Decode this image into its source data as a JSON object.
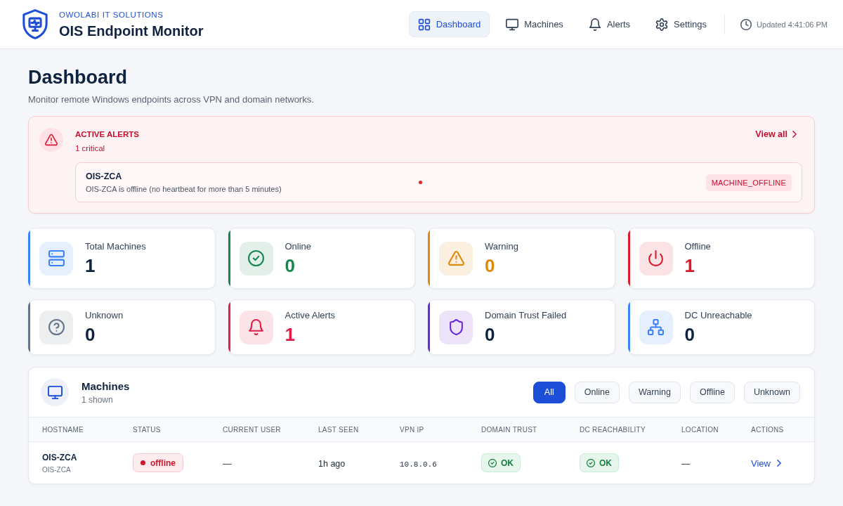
{
  "header": {
    "brand": "OWOLABI IT SOLUTIONS",
    "title": "OIS Endpoint Monitor",
    "nav": [
      {
        "label": "Dashboard",
        "kind": "grid",
        "selected": true
      },
      {
        "label": "Machines",
        "kind": "monitor",
        "selected": false
      },
      {
        "label": "Alerts",
        "kind": "bell",
        "selected": false
      },
      {
        "label": "Settings",
        "kind": "gear",
        "selected": false
      }
    ],
    "updated": "Updated 4:41:06 PM"
  },
  "page": {
    "title": "Dashboard",
    "subtitle": "Monitor remote Windows endpoints across VPN and domain networks."
  },
  "alerts": {
    "title": "ACTIVE ALERTS",
    "summary": "1 critical",
    "link": "View all",
    "items": [
      {
        "host": "OIS-ZCA",
        "message": "OIS-ZCA is offline (no heartbeat for more than 5 minutes)",
        "color": "#dc2626",
        "type": "MACHINE_OFFLINE"
      }
    ]
  },
  "stats": [
    {
      "label": "Total Machines",
      "value": "1",
      "kind": "server",
      "color": "#3b82f6",
      "emphasized": false
    },
    {
      "label": "Online",
      "value": "0",
      "kind": "check",
      "color": "#16874f",
      "emphasized": true
    },
    {
      "label": "Warning",
      "value": "0",
      "kind": "warning",
      "color": "#e08a0a",
      "emphasized": true
    },
    {
      "label": "Offline",
      "value": "1",
      "kind": "power",
      "color": "#d81c2e",
      "emphasized": true
    },
    {
      "label": "Unknown",
      "value": "0",
      "kind": "question",
      "color": "#64748b",
      "emphasized": false
    },
    {
      "label": "Active Alerts",
      "value": "1",
      "kind": "bell",
      "color": "#e11d48",
      "emphasized": true
    },
    {
      "label": "Domain Trust Failed",
      "value": "0",
      "kind": "shield",
      "color": "#6d28d9",
      "emphasized": false
    },
    {
      "label": "DC Unreachable",
      "value": "0",
      "kind": "network",
      "color": "#3b82f6",
      "emphasized": false
    }
  ],
  "machines": {
    "title": "Machines",
    "count": "1 shown",
    "filters": [
      {
        "label": "All",
        "selected": true
      },
      {
        "label": "Online",
        "selected": false
      },
      {
        "label": "Warning",
        "selected": false
      },
      {
        "label": "Offline",
        "selected": false
      },
      {
        "label": "Unknown",
        "selected": false
      }
    ],
    "columns": [
      "HOSTNAME",
      "STATUS",
      "CURRENT USER",
      "LAST SEEN",
      "VPN IP",
      "DOMAIN TRUST",
      "DC REACHABILITY",
      "LOCATION",
      "ACTIONS"
    ],
    "rows": [
      {
        "hostname": "OIS-ZCA",
        "host_detail": "OIS-ZCA",
        "status": {
          "text": "offline",
          "kind": "offline"
        },
        "current_user": "—",
        "last_seen": "1h ago",
        "vpn_ip": "10.8.0.6",
        "domain_trust": {
          "text": "OK",
          "kind": "ok"
        },
        "dc_reachability": {
          "text": "OK",
          "kind": "ok"
        },
        "location": "—",
        "action": "View"
      }
    ]
  }
}
